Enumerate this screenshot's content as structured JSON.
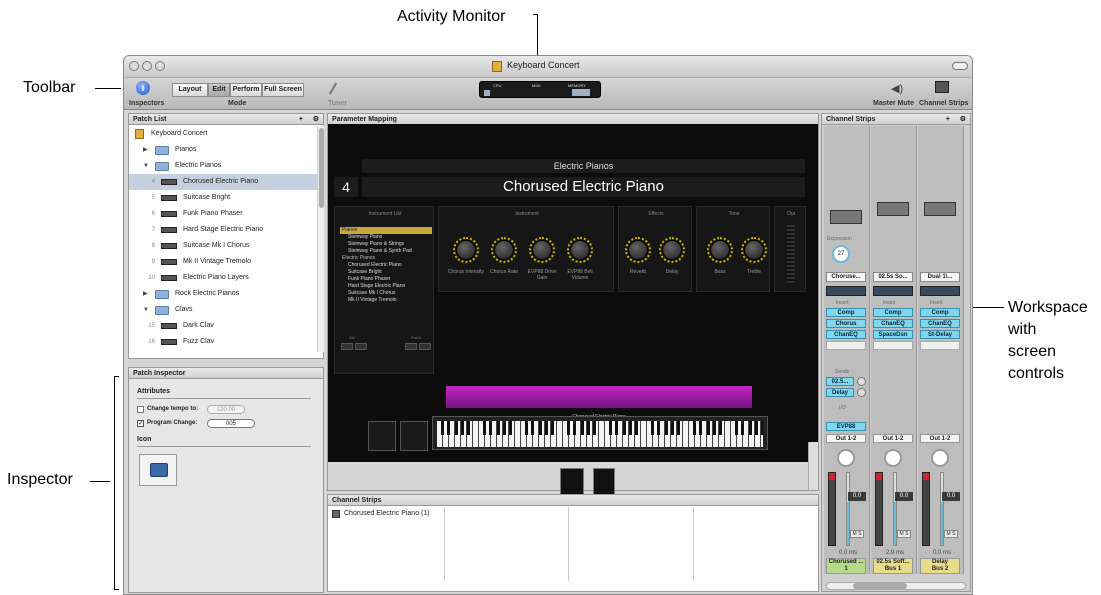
{
  "callouts": {
    "activity_monitor": "Activity Monitor",
    "toolbar": "Toolbar",
    "workspace_line1": "Workspace",
    "workspace_line2": "with",
    "workspace_line3": "screen",
    "workspace_line4": "controls",
    "inspector": "Inspector"
  },
  "window": {
    "title": "Keyboard Concert"
  },
  "toolbar": {
    "inspectors_label": "Inspectors",
    "mode_label": "Mode",
    "modes": [
      "Layout",
      "Edit",
      "Perform",
      "Full Screen"
    ],
    "tuner_label": "Tuner",
    "monitor": {
      "cpu": "CPU",
      "midi": "MIDI",
      "memory": "MEMORY"
    },
    "master_mute_label": "Master Mute",
    "channel_strips_label": "Channel Strips"
  },
  "patch_list": {
    "title": "Patch List",
    "add": "+",
    "gear": "⚙",
    "items": [
      {
        "label": "Keyboard Concert",
        "num": "",
        "kind": "concert"
      },
      {
        "label": "Pianos",
        "num": "",
        "kind": "folder-closed"
      },
      {
        "label": "Electric Pianos",
        "num": "",
        "kind": "folder-open"
      },
      {
        "label": "Chorused Electric Piano",
        "num": "4",
        "kind": "patch",
        "selected": true
      },
      {
        "label": "Suitcase Bright",
        "num": "5",
        "kind": "patch"
      },
      {
        "label": "Funk Piano Phaser",
        "num": "6",
        "kind": "patch"
      },
      {
        "label": "Hard Stage Electric Piano",
        "num": "7",
        "kind": "patch"
      },
      {
        "label": "Suitcase Mk I Chorus",
        "num": "8",
        "kind": "patch"
      },
      {
        "label": "Mk II Vintage Tremolo",
        "num": "9",
        "kind": "patch"
      },
      {
        "label": "Electric Piano Layers",
        "num": "10",
        "kind": "patch"
      },
      {
        "label": "Rock Electric Pianos",
        "num": "",
        "kind": "folder-closed"
      },
      {
        "label": "Clavs",
        "num": "",
        "kind": "folder-open"
      },
      {
        "label": "Dark Clav",
        "num": "15",
        "kind": "patch"
      },
      {
        "label": "Fuzz Clav",
        "num": "16",
        "kind": "patch"
      }
    ]
  },
  "inspector": {
    "title": "Patch Inspector",
    "attributes": "Attributes",
    "change_tempo_label": "Change tempo to:",
    "tempo_value": "120.00",
    "program_change_label": "Program Change:",
    "program_value": "005",
    "icon_label": "Icon"
  },
  "param_mapping": {
    "title": "Parameter Mapping",
    "folder_name": "Electric Pianos",
    "patch_number": "4",
    "patch_name": "Chorused Electric Piano",
    "sections": [
      "Instrument List",
      "Instrument",
      "Effects",
      "Tone",
      "Out"
    ],
    "instrument_list": [
      "Pianos",
      "Steinway Piano",
      "Steinway Piano & Strings",
      "Steinway Piano & Synth Pad",
      "Electric Pianos",
      "Chorused Electric Piano",
      "Suitcase Bright",
      "Funk Piano Phaser",
      "Hard Stage Electric Piano",
      "Suitcase Mk I Chorus",
      "Mk II Vintage Tremolo"
    ],
    "list_footer_left": "Set",
    "list_footer_right": "Patch",
    "knobs": [
      {
        "label": "Chorus Intensity"
      },
      {
        "label": "Chorus Rate"
      },
      {
        "label": "EVP88 Drive Gain"
      },
      {
        "label": "EVP88 Bell Volume"
      },
      {
        "label": "Reverb"
      },
      {
        "label": "Delay"
      },
      {
        "label": "Bass"
      },
      {
        "label": "Treble"
      }
    ],
    "keyboard_label": "Chorused Electric Piano"
  },
  "bottom_strips": {
    "title": "Channel Strips",
    "item": "Chorused Electric Piano (1)"
  },
  "channel_strips": {
    "title": "Channel Strips",
    "add": "+",
    "gear": "⚙",
    "expression_label": "Expression",
    "expression_value": "27",
    "insert_label": "Insert",
    "sends_label": "Sends",
    "io_label": "I/O",
    "strips": [
      {
        "setting": "Choruse...",
        "inserts": [
          "Comp",
          "Chorus",
          "ChanEQ"
        ],
        "sends": [
          "02.5...",
          "Delay"
        ],
        "input": "EVP88",
        "output": "Out 1-2",
        "fader": "0.0",
        "latency": "0.0 ms",
        "name": "Chorused ...",
        "name2": "1",
        "name_color": "#b6d98a"
      },
      {
        "setting": "02.5s So...",
        "inserts": [
          "Comp",
          "ChanEQ",
          "SpaceDsn"
        ],
        "sends": [],
        "input": "",
        "output": "Out 1-2",
        "fader": "0.0",
        "latency": "2.9 ms",
        "name": "02.5s Soft...",
        "name2": "Bus 1",
        "name_color": "#e8dc8a"
      },
      {
        "setting": "Dual 1\\...",
        "inserts": [
          "Comp",
          "ChanEQ",
          "St-Delay"
        ],
        "sends": [],
        "input": "",
        "output": "Out 1-2",
        "fader": "0.0",
        "latency": "0.0 ms",
        "name": "Delay",
        "name2": "Bus 2",
        "name_color": "#e8dc8a"
      }
    ]
  }
}
